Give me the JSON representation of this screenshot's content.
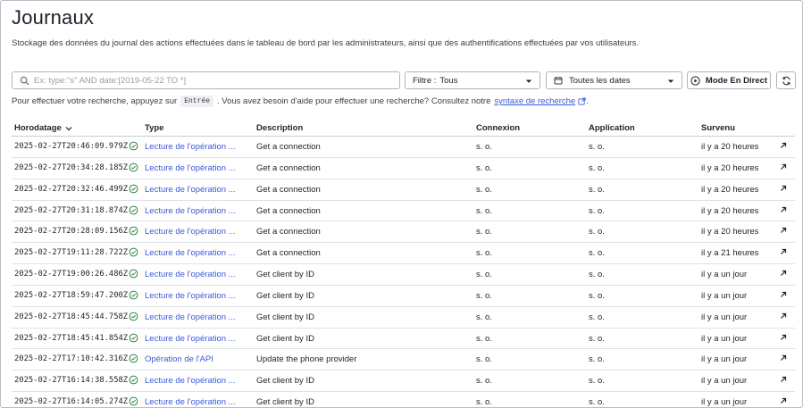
{
  "page": {
    "title": "Journaux",
    "subtitle": "Stockage des données du journal des actions effectuées dans le tableau de bord par les administrateurs, ainsi que des authentifications effectuées par vos utilisateurs."
  },
  "search": {
    "placeholder": "Ex: type:\"s\" AND date:[2019-05-22 TO *]",
    "value": ""
  },
  "filter": {
    "label": "Filtre :",
    "value": "Tous"
  },
  "dates": {
    "label": "Toutes les dates"
  },
  "live_button": {
    "label": "Mode En Direct"
  },
  "hint": {
    "before": "Pour effectuer votre recherche, appuyez sur",
    "key": "Entrée",
    "middle": ". Vous avez besoin d'aide pour effectuer une recherche? Consultez notre",
    "link": "syntaxe de recherche",
    "after": "."
  },
  "table": {
    "columns": {
      "time": "Horodatage",
      "type": "Type",
      "description": "Description",
      "connection": "Connexion",
      "application": "Application",
      "occurred": "Survenu"
    },
    "rows": [
      {
        "time": "2025-02-27T20:46:09.979Z",
        "type": "Lecture de l'opération ...",
        "description": "Get a connection",
        "connection": "s. o.",
        "application": "s. o.",
        "occurred": "il y a 20 heures"
      },
      {
        "time": "2025-02-27T20:34:28.185Z",
        "type": "Lecture de l'opération ...",
        "description": "Get a connection",
        "connection": "s. o.",
        "application": "s. o.",
        "occurred": "il y a 20 heures"
      },
      {
        "time": "2025-02-27T20:32:46.499Z",
        "type": "Lecture de l'opération ...",
        "description": "Get a connection",
        "connection": "s. o.",
        "application": "s. o.",
        "occurred": "il y a 20 heures"
      },
      {
        "time": "2025-02-27T20:31:18.874Z",
        "type": "Lecture de l'opération ...",
        "description": "Get a connection",
        "connection": "s. o.",
        "application": "s. o.",
        "occurred": "il y a 20 heures"
      },
      {
        "time": "2025-02-27T20:28:09.156Z",
        "type": "Lecture de l'opération ...",
        "description": "Get a connection",
        "connection": "s. o.",
        "application": "s. o.",
        "occurred": "il y a 20 heures"
      },
      {
        "time": "2025-02-27T19:11:28.722Z",
        "type": "Lecture de l'opération ...",
        "description": "Get a connection",
        "connection": "s. o.",
        "application": "s. o.",
        "occurred": "il y a 21 heures"
      },
      {
        "time": "2025-02-27T19:00:26.486Z",
        "type": "Lecture de l'opération ...",
        "description": "Get client by ID",
        "connection": "s. o.",
        "application": "s. o.",
        "occurred": "il y a un jour"
      },
      {
        "time": "2025-02-27T18:59:47.200Z",
        "type": "Lecture de l'opération ...",
        "description": "Get client by ID",
        "connection": "s. o.",
        "application": "s. o.",
        "occurred": "il y a un jour"
      },
      {
        "time": "2025-02-27T18:45:44.758Z",
        "type": "Lecture de l'opération ...",
        "description": "Get client by ID",
        "connection": "s. o.",
        "application": "s. o.",
        "occurred": "il y a un jour"
      },
      {
        "time": "2025-02-27T18:45:41.854Z",
        "type": "Lecture de l'opération ...",
        "description": "Get client by ID",
        "connection": "s. o.",
        "application": "s. o.",
        "occurred": "il y a un jour"
      },
      {
        "time": "2025-02-27T17:10:42.316Z",
        "type": "Opération de l'API",
        "description": "Update the phone provider",
        "connection": "s. o.",
        "application": "s. o.",
        "occurred": "il y a un jour"
      },
      {
        "time": "2025-02-27T16:14:38.558Z",
        "type": "Lecture de l'opération ...",
        "description": "Get client by ID",
        "connection": "s. o.",
        "application": "s. o.",
        "occurred": "il y a un jour"
      },
      {
        "time": "2025-02-27T16:14:05.274Z",
        "type": "Lecture de l'opération ...",
        "description": "Get client by ID",
        "connection": "s. o.",
        "application": "s. o.",
        "occurred": "il y a un jour"
      }
    ]
  },
  "colors": {
    "link": "#3b5bdb",
    "success": "#2e8540",
    "border": "#b3b5bc"
  },
  "icons": {
    "search": "search-icon",
    "chevron": "chevron-down-icon",
    "calendar": "calendar-icon",
    "play": "play-circle-icon",
    "refresh": "refresh-icon",
    "sort": "sort-down-icon",
    "status": "check-circle-icon",
    "open": "arrow-up-right-icon",
    "external": "external-link-icon"
  }
}
